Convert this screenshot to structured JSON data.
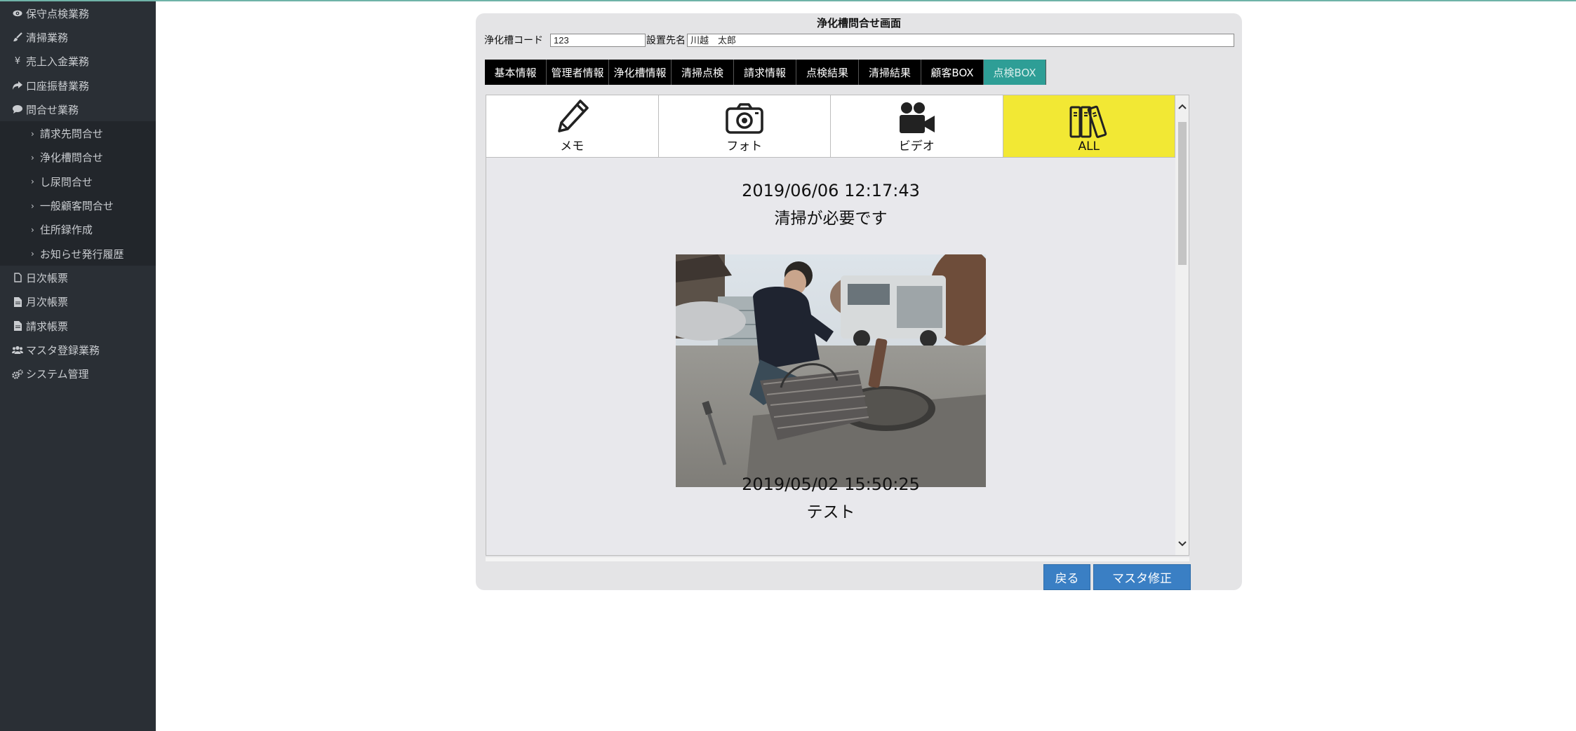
{
  "sidebar": {
    "items": [
      {
        "label": "保守点検業務",
        "icon": "eye-icon"
      },
      {
        "label": "清掃業務",
        "icon": "brush-icon"
      },
      {
        "label": "売上入金業務",
        "icon": "yen-icon"
      },
      {
        "label": "口座振替業務",
        "icon": "share-arrow-icon"
      },
      {
        "label": "問合せ業務",
        "icon": "speech-bubble-icon"
      }
    ],
    "submenu": [
      {
        "label": "請求先問合せ"
      },
      {
        "label": "浄化槽問合せ"
      },
      {
        "label": "し尿問合せ"
      },
      {
        "label": "一般顧客問合せ"
      },
      {
        "label": "住所録作成"
      },
      {
        "label": "お知らせ発行履歴"
      }
    ],
    "items_after": [
      {
        "label": "日次帳票",
        "icon": "document-icon"
      },
      {
        "label": "月次帳票",
        "icon": "document-filled-icon"
      },
      {
        "label": "請求帳票",
        "icon": "document-filled-icon"
      },
      {
        "label": "マスタ登録業務",
        "icon": "users-icon"
      },
      {
        "label": "システム管理",
        "icon": "gears-icon"
      }
    ]
  },
  "panel": {
    "title": "浄化槽問合せ画面",
    "code_label": "浄化槽コード",
    "code_value": "123",
    "name_label": "設置先名",
    "name_value": "川越　太郎"
  },
  "tabs": [
    {
      "label": "基本情報"
    },
    {
      "label": "管理者情報"
    },
    {
      "label": "浄化槽情報"
    },
    {
      "label": "清掃点検"
    },
    {
      "label": "請求情報"
    },
    {
      "label": "点検結果"
    },
    {
      "label": "清掃結果"
    },
    {
      "label": "顧客BOX"
    },
    {
      "label": "点検BOX",
      "active": true
    }
  ],
  "filters": [
    {
      "label": "メモ",
      "icon": "pencil-icon"
    },
    {
      "label": "フォト",
      "icon": "camera-icon"
    },
    {
      "label": "ビデオ",
      "icon": "video-camera-icon"
    },
    {
      "label": "ALL",
      "icon": "books-icon",
      "active": true
    }
  ],
  "entries": [
    {
      "timestamp": "2019/06/06 12:17:43",
      "text": "清掃が必要です"
    },
    {
      "timestamp": "2019/05/02 15:50:25",
      "text": "テスト"
    }
  ],
  "buttons": {
    "back": "戻る",
    "edit": "マスタ修正"
  },
  "colors": {
    "sidebar_bg": "#2a2f35",
    "tab_bg": "#000000",
    "tab_active": "#2e9e96",
    "filter_active": "#f2e834",
    "button": "#3a7fc4"
  }
}
